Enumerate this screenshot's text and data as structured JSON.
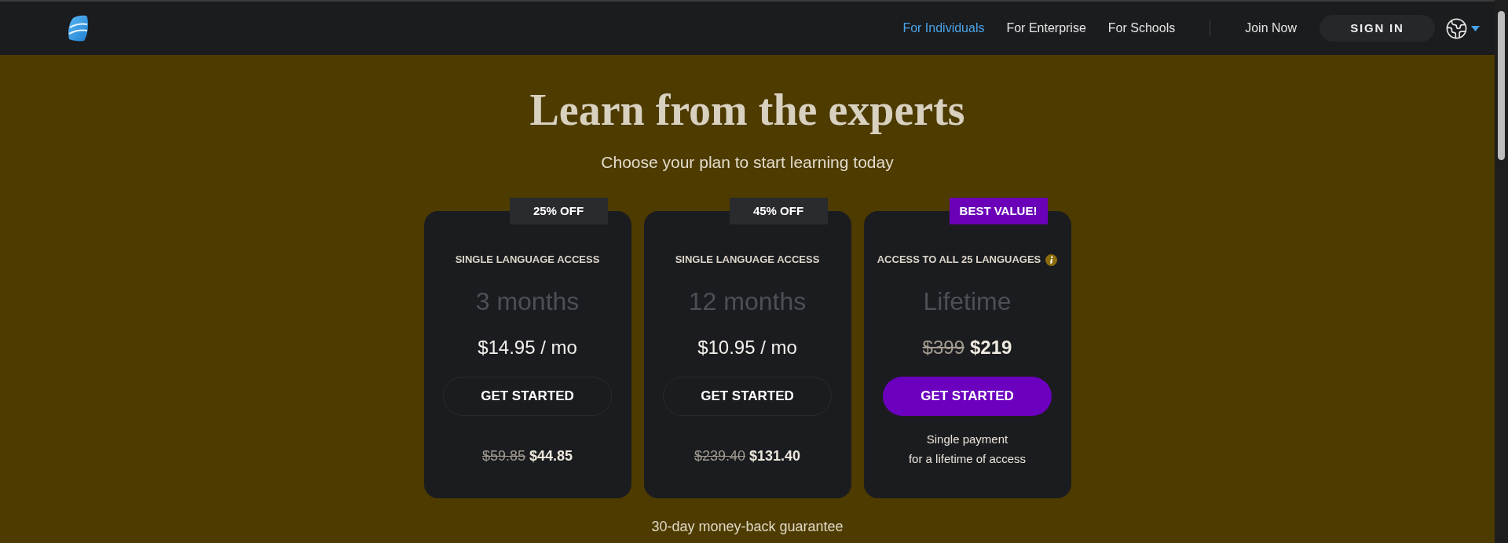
{
  "nav": {
    "links": [
      {
        "label": "For Individuals",
        "selected": true
      },
      {
        "label": "For Enterprise",
        "selected": false
      },
      {
        "label": "For Schools",
        "selected": false
      }
    ],
    "join": "Join Now",
    "sign_in": "SIGN IN"
  },
  "hero": {
    "title": "Learn from the experts",
    "subtitle": "Choose your plan to start learning today"
  },
  "plans": [
    {
      "kind": "standard",
      "badge": "25% OFF",
      "access": "SINGLE LANGUAGE ACCESS",
      "term": "3 months",
      "price": "$14.95 / mo",
      "button": "GET STARTED",
      "old_total": "$59.85",
      "total": "$44.85"
    },
    {
      "kind": "standard",
      "badge": "45% OFF",
      "access": "SINGLE LANGUAGE ACCESS",
      "term": "12 months",
      "price": "$10.95 / mo",
      "button": "GET STARTED",
      "old_total": "$239.40",
      "total": "$131.40"
    },
    {
      "kind": "lifetime",
      "badge": "BEST VALUE!",
      "access": "ACCESS TO ALL 25 LANGUAGES",
      "term": "Lifetime",
      "old_price": "$399",
      "price": "$219",
      "button": "GET STARTED",
      "note": "Single payment\nfor a lifetime of access"
    }
  ],
  "guarantee": "30-day money-back guarantee"
}
